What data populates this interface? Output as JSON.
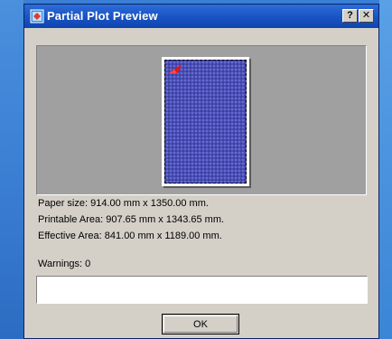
{
  "window": {
    "title": "Partial Plot Preview",
    "help_label": "?",
    "close_label": "✕"
  },
  "icons": {
    "title": "plot-preview-icon",
    "help": "help-icon",
    "close": "close-icon"
  },
  "info": {
    "paper_size": "Paper size:  914.00 mm x 1350.00 mm.",
    "printable_area": "Printable Area:  907.65 mm x 1343.65 mm.",
    "effective_area": "Effective Area:  841.00 mm x 1189.00 mm."
  },
  "warnings": {
    "label": "Warnings:  0",
    "text": ""
  },
  "buttons": {
    "ok": "OK"
  },
  "colors": {
    "titlebar": "#1a55c4",
    "dialog_face": "#d4d0c8",
    "preview_background": "#a0a0a0",
    "plot_area": "#4a4fb6",
    "origin_marker": "#e01818"
  }
}
